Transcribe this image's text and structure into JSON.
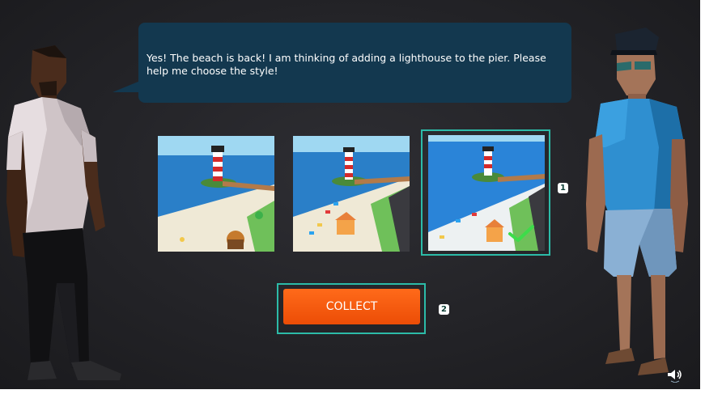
{
  "dialog": {
    "text": "Yes! The beach is back! I am thinking of adding a lighthouse to the pier. Please help me choose the style!"
  },
  "options": [
    {
      "id": "style-1",
      "selected": false
    },
    {
      "id": "style-2",
      "selected": false
    },
    {
      "id": "style-3",
      "selected": true
    }
  ],
  "markers": {
    "options": "1",
    "collect": "2"
  },
  "collect": {
    "label": "COLLECT"
  },
  "colors": {
    "accent": "#2cbba8",
    "button": "#f2560c",
    "bubble": "#13384f",
    "check": "#3ddc4a"
  },
  "icons": {
    "sound": "speaker-icon",
    "selected": "checkmark-icon"
  }
}
